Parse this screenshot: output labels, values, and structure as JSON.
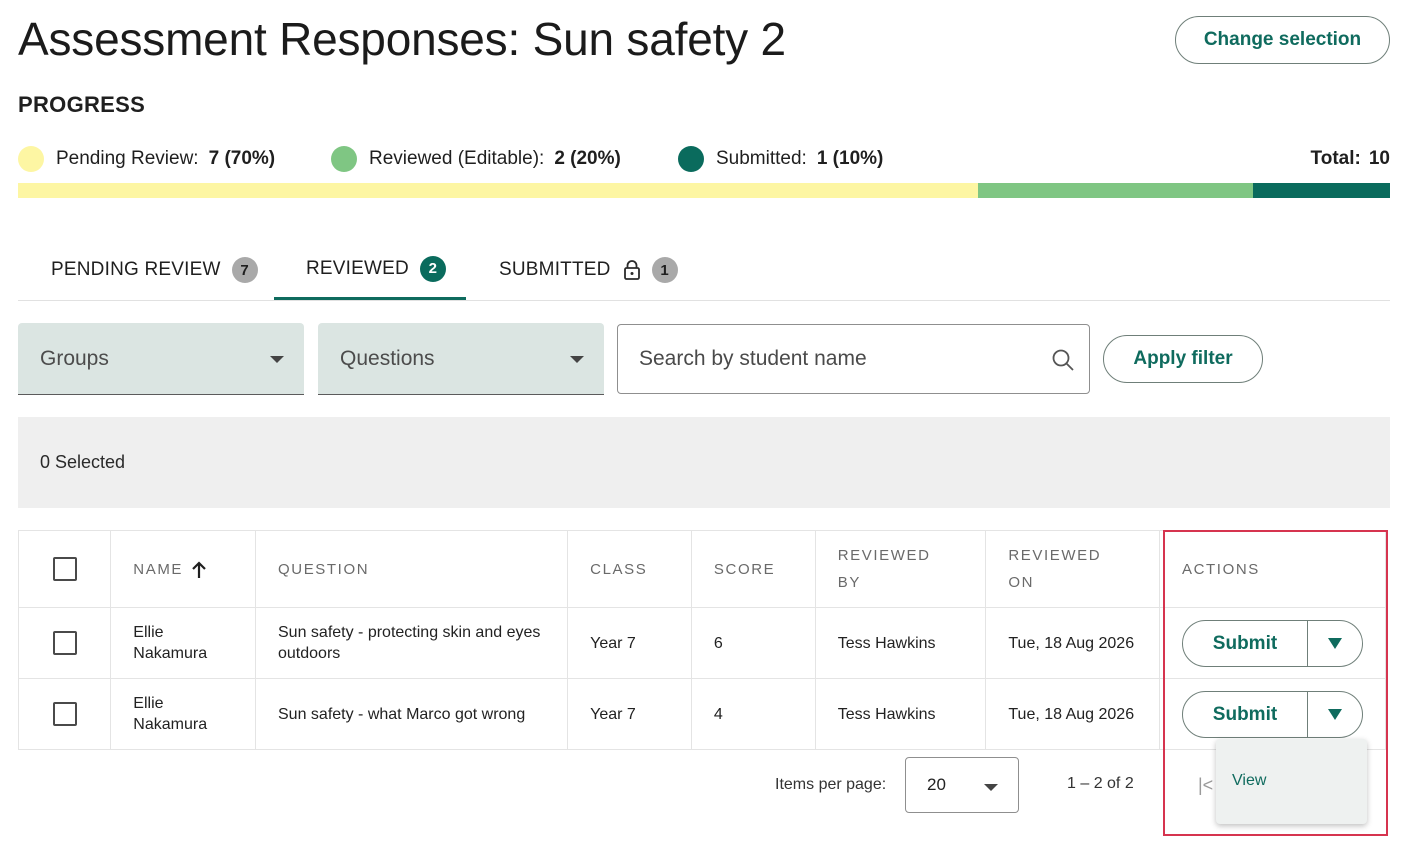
{
  "header": {
    "title": "Assessment Responses: Sun safety 2",
    "change_selection_label": "Change selection"
  },
  "progress": {
    "heading": "PROGRESS",
    "legend": [
      {
        "label": "Pending Review:",
        "value": "7 (70%)",
        "color": "#fdf6a3",
        "fraction": 0.7
      },
      {
        "label": "Reviewed (Editable):",
        "value": "2 (20%)",
        "color": "#7fc683",
        "fraction": 0.2
      },
      {
        "label": "Submitted:",
        "value": "1 (10%)",
        "color": "#0a6b5d",
        "fraction": 0.1
      }
    ],
    "total_label": "Total:",
    "total_value": "10"
  },
  "tabs": [
    {
      "label": "PENDING REVIEW",
      "count": "7"
    },
    {
      "label": "REVIEWED",
      "count": "2"
    },
    {
      "label": "SUBMITTED",
      "count": "1",
      "icon": "lock-icon"
    }
  ],
  "filters": {
    "groups_label": "Groups",
    "questions_label": "Questions",
    "search_placeholder": "Search by student name",
    "apply_label": "Apply filter"
  },
  "selection": {
    "text": "0 Selected"
  },
  "table": {
    "headers": {
      "name": "NAME",
      "question": "QUESTION",
      "class": "CLASS",
      "score": "SCORE",
      "reviewed_by": "REVIEWED BY",
      "reviewed_on": "REVIEWED ON",
      "actions": "ACTIONS"
    },
    "rows": [
      {
        "name": "Ellie Nakamura",
        "question": "Sun safety - protecting skin and eyes outdoors",
        "class": "Year 7",
        "score": "6",
        "reviewed_by": "Tess Hawkins",
        "reviewed_on": "Tue, 18 Aug 2026",
        "action": "Submit"
      },
      {
        "name": "Ellie Nakamura",
        "question": "Sun safety - what Marco got wrong",
        "class": "Year 7",
        "score": "4",
        "reviewed_by": "Tess Hawkins",
        "reviewed_on": "Tue, 18 Aug 2026",
        "action": "Submit"
      }
    ]
  },
  "pagination": {
    "items_per_page_label": "Items per page:",
    "items_per_page_value": "20",
    "range": "1 – 2 of 2"
  },
  "dropdown_menu": {
    "items": [
      "View"
    ]
  }
}
